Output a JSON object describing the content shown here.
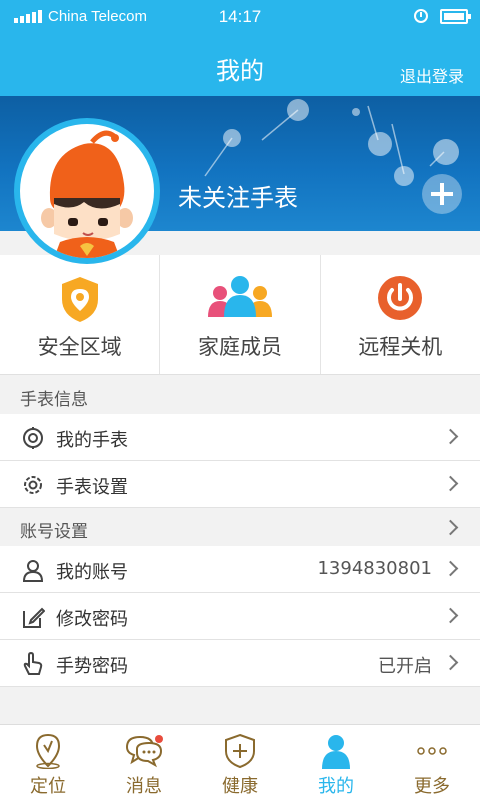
{
  "status_bar": {
    "carrier": "China Telecom",
    "time": "14:17"
  },
  "header": {
    "title": "我的",
    "logout": "退出登录"
  },
  "banner": {
    "watch_status": "未关注手表"
  },
  "quick_actions": [
    {
      "label": "安全区域",
      "icon": "shield-pin-icon"
    },
    {
      "label": "家庭成员",
      "icon": "family-members-icon"
    },
    {
      "label": "远程关机",
      "icon": "power-icon"
    }
  ],
  "watch_section": {
    "title": "手表信息",
    "items": [
      {
        "label": "我的手表",
        "icon": "watch-icon"
      },
      {
        "label": "手表设置",
        "icon": "gear-icon"
      }
    ]
  },
  "account_section": {
    "title": "账号设置",
    "items": [
      {
        "label": "我的账号",
        "value": "1394830801",
        "icon": "person-icon"
      },
      {
        "label": "修改密码",
        "icon": "edit-icon"
      },
      {
        "label": "手势密码",
        "value": "已开启",
        "icon": "hand-pointer-icon"
      }
    ]
  },
  "tabs": [
    {
      "label": "定位",
      "icon": "location-icon"
    },
    {
      "label": "消息",
      "icon": "chat-icon"
    },
    {
      "label": "健康",
      "icon": "health-shield-icon"
    },
    {
      "label": "我的",
      "icon": "person-icon"
    },
    {
      "label": "更多",
      "icon": "more-dots-icon"
    }
  ],
  "colors": {
    "primary": "#29b6ec",
    "banner": "#1273c0",
    "accent_orange": "#f06a1e",
    "tab_inactive": "#8a6a2e"
  }
}
